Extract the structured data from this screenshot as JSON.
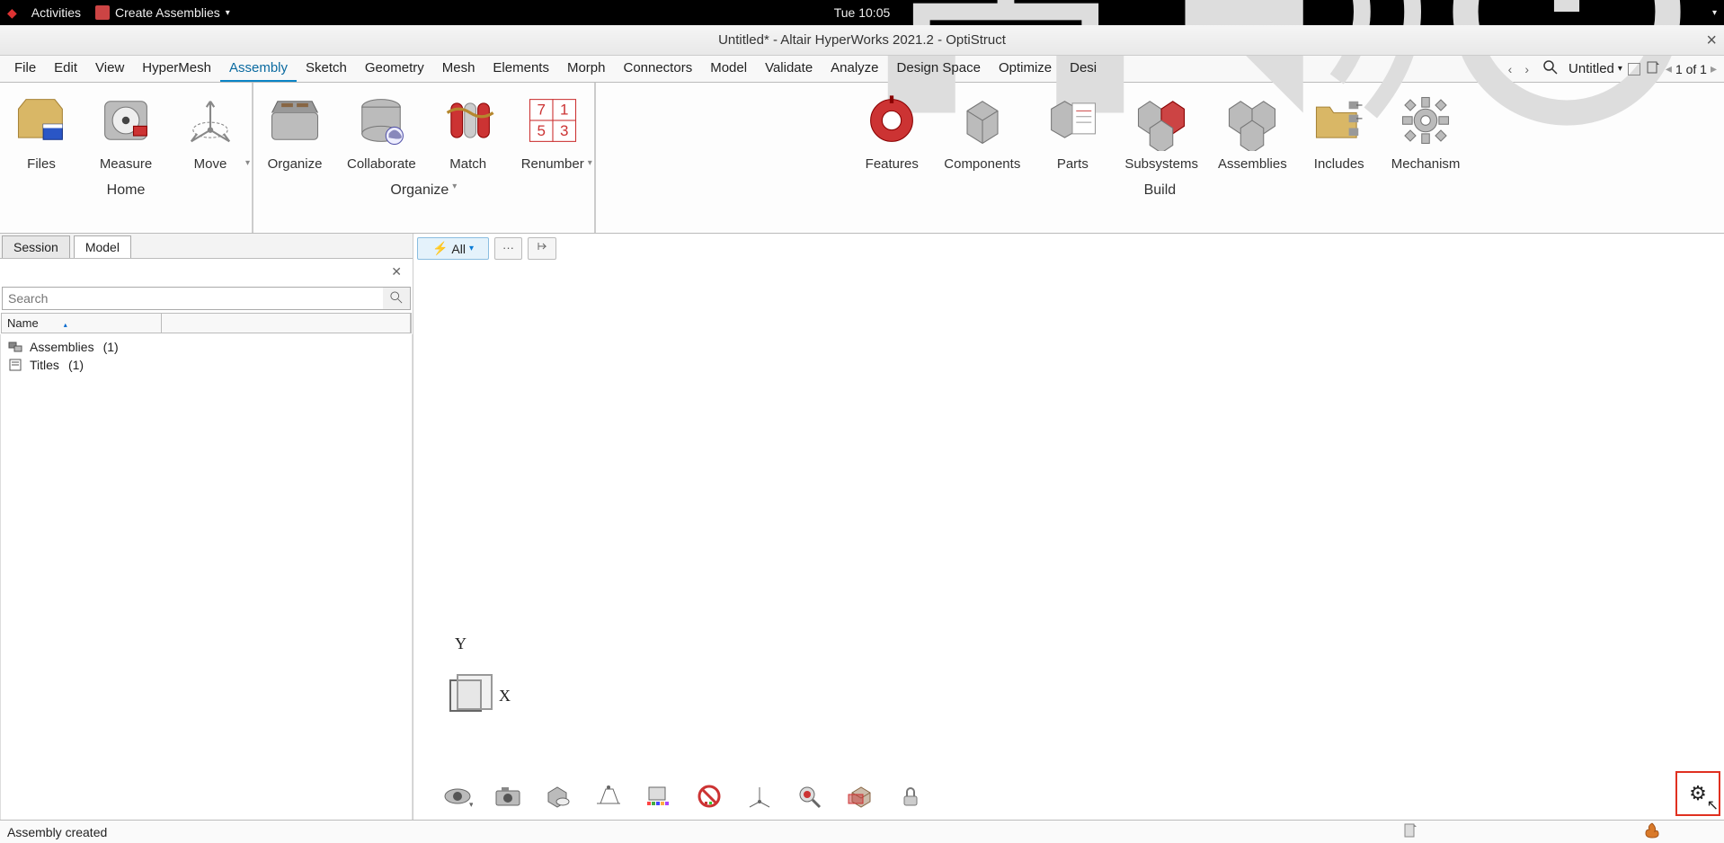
{
  "os": {
    "activities": "Activities",
    "app_menu": "Create Assemblies",
    "datetime": "Tue 10:05"
  },
  "window": {
    "title": "Untitled* - Altair HyperWorks 2021.2 - OptiStruct"
  },
  "menu": {
    "items": [
      "File",
      "Edit",
      "View",
      "HyperMesh",
      "Assembly",
      "Sketch",
      "Geometry",
      "Mesh",
      "Elements",
      "Morph",
      "Connectors",
      "Model",
      "Validate",
      "Analyze",
      "Design Space",
      "Optimize",
      "Desi"
    ],
    "active": "Assembly",
    "untitled_label": "Untitled",
    "page_indicator": "1 of 1"
  },
  "ribbon": {
    "home": {
      "label": "Home",
      "items": [
        {
          "label": "Files"
        },
        {
          "label": "Measure"
        },
        {
          "label": "Move"
        }
      ]
    },
    "organize": {
      "label": "Organize",
      "items": [
        {
          "label": "Organize"
        },
        {
          "label": "Collaborate"
        },
        {
          "label": "Match"
        },
        {
          "label": "Renumber"
        }
      ]
    },
    "build": {
      "label": "Build",
      "items": [
        {
          "label": "Features"
        },
        {
          "label": "Components"
        },
        {
          "label": "Parts"
        },
        {
          "label": "Subsystems"
        },
        {
          "label": "Assemblies"
        },
        {
          "label": "Includes"
        },
        {
          "label": "Mechanism"
        }
      ]
    }
  },
  "panel": {
    "tabs": {
      "session": "Session",
      "model": "Model"
    },
    "search_placeholder": "Search",
    "name_col": "Name",
    "tree": [
      {
        "label": "Assemblies",
        "count": "(1)"
      },
      {
        "label": "Titles",
        "count": "(1)"
      }
    ]
  },
  "viewport": {
    "filter_label": "All",
    "more_label": "···",
    "axes": {
      "x": "X",
      "y": "Y"
    }
  },
  "status": {
    "message": "Assembly created"
  }
}
